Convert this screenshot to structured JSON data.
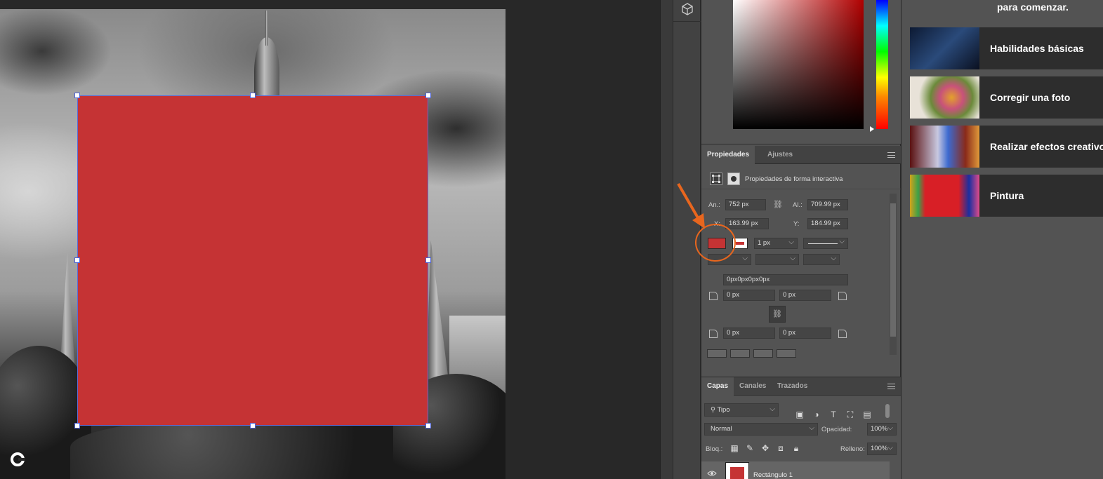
{
  "canvas": {
    "rectangle_fill": "#c53334"
  },
  "toolbar": {
    "tool_icon": "3d-cube-icon"
  },
  "properties_panel": {
    "tabs": [
      "Propiedades",
      "Ajustes"
    ],
    "shape_section_title": "Propiedades de forma interactiva",
    "width_label": "An.:",
    "width_value": "752 px",
    "height_label": "Al.:",
    "height_value": "709.99 px",
    "x_label": "X:",
    "x_value": "163.99 px",
    "y_label": "Y:",
    "y_value": "184.99 px",
    "stroke_width": "1 px",
    "corner_radii_combined": "0px0px0px0px",
    "corner_tl": "0 px",
    "corner_tr": "0 px",
    "corner_bl": "0 px",
    "corner_br": "0 px",
    "fill_color": "#c53334"
  },
  "layers_panel": {
    "tabs": [
      "Capas",
      "Canales",
      "Trazados"
    ],
    "filter_label": "Tipo",
    "blend_mode": "Normal",
    "opacity_label": "Opacidad:",
    "opacity_value": "100%",
    "lock_label": "Bloq.:",
    "fill_label": "Relleno:",
    "fill_value": "100%",
    "layers": [
      {
        "name": "Rectángulo 1",
        "visible": true
      }
    ]
  },
  "learn_panel": {
    "heading": "para comenzar.",
    "cards": [
      {
        "label": "Habilidades básicas"
      },
      {
        "label": "Corregir una foto"
      },
      {
        "label": "Realizar efectos creativos"
      },
      {
        "label": "Pintura"
      }
    ]
  },
  "annotation": {
    "color": "#e8661e"
  }
}
